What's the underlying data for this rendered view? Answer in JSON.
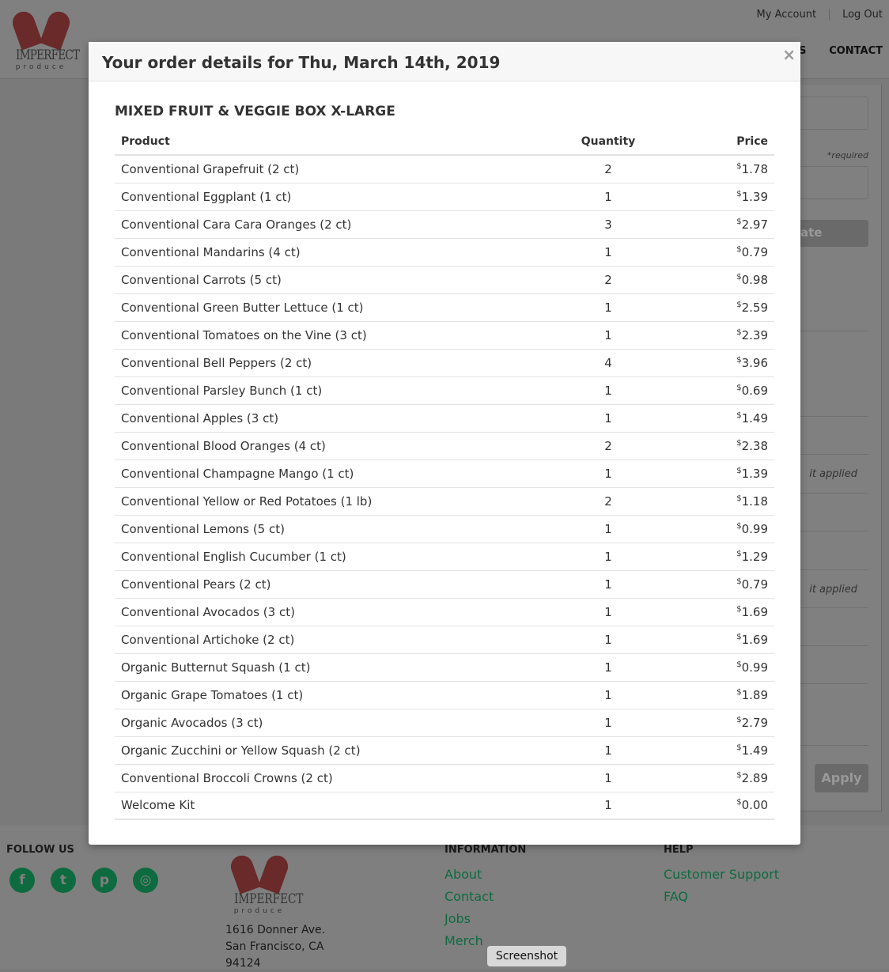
{
  "header": {
    "logo_top": "IMPERFECT",
    "logo_bottom": "produce",
    "my_account": "My Account",
    "log_out": "Log Out",
    "nav_partial": "S",
    "nav_contact": "CONTACT"
  },
  "sidebar": {
    "required": "*required",
    "update_partial": "ate",
    "credit_partial_1": "it applied",
    "credit_partial_2": "it applied",
    "apply": "Apply"
  },
  "modal": {
    "title": "Your order details for Thu, March 14th, 2019",
    "close": "×",
    "box_title": "MIXED FRUIT & VEGGIE BOX X-LARGE",
    "columns": {
      "product": "Product",
      "quantity": "Quantity",
      "price": "Price"
    },
    "currency": "$",
    "rows": [
      {
        "product": "Conventional Grapefruit (2 ct)",
        "quantity": "2",
        "price": "1.78"
      },
      {
        "product": "Conventional Eggplant (1 ct)",
        "quantity": "1",
        "price": "1.39"
      },
      {
        "product": "Conventional Cara Cara Oranges (2 ct)",
        "quantity": "3",
        "price": "2.97"
      },
      {
        "product": "Conventional Mandarins (4 ct)",
        "quantity": "1",
        "price": "0.79"
      },
      {
        "product": "Conventional Carrots (5 ct)",
        "quantity": "2",
        "price": "0.98"
      },
      {
        "product": "Conventional Green Butter Lettuce (1 ct)",
        "quantity": "1",
        "price": "2.59"
      },
      {
        "product": "Conventional Tomatoes on the Vine (3 ct)",
        "quantity": "1",
        "price": "2.39"
      },
      {
        "product": "Conventional Bell Peppers (2 ct)",
        "quantity": "4",
        "price": "3.96"
      },
      {
        "product": "Conventional Parsley Bunch (1 ct)",
        "quantity": "1",
        "price": "0.69"
      },
      {
        "product": "Conventional Apples (3 ct)",
        "quantity": "1",
        "price": "1.49"
      },
      {
        "product": "Conventional Blood Oranges (4 ct)",
        "quantity": "2",
        "price": "2.38"
      },
      {
        "product": "Conventional Champagne Mango (1 ct)",
        "quantity": "1",
        "price": "1.39"
      },
      {
        "product": "Conventional Yellow or Red Potatoes (1 lb)",
        "quantity": "2",
        "price": "1.18"
      },
      {
        "product": "Conventional Lemons (5 ct)",
        "quantity": "1",
        "price": "0.99"
      },
      {
        "product": "Conventional English Cucumber (1 ct)",
        "quantity": "1",
        "price": "1.29"
      },
      {
        "product": "Conventional Pears (2 ct)",
        "quantity": "1",
        "price": "0.79"
      },
      {
        "product": "Conventional Avocados (3 ct)",
        "quantity": "1",
        "price": "1.69"
      },
      {
        "product": "Conventional Artichoke (2 ct)",
        "quantity": "1",
        "price": "1.69"
      },
      {
        "product": "Organic Butternut Squash (1 ct)",
        "quantity": "1",
        "price": "0.99"
      },
      {
        "product": "Organic Grape Tomatoes (1 ct)",
        "quantity": "1",
        "price": "1.89"
      },
      {
        "product": "Organic Avocados (3 ct)",
        "quantity": "1",
        "price": "2.79"
      },
      {
        "product": "Organic Zucchini or Yellow Squash (2 ct)",
        "quantity": "1",
        "price": "1.49"
      },
      {
        "product": "Conventional Broccoli Crowns (2 ct)",
        "quantity": "1",
        "price": "2.89"
      },
      {
        "product": "Welcome Kit",
        "quantity": "1",
        "price": "0.00"
      }
    ]
  },
  "footer": {
    "follow_us": "FOLLOW US",
    "social": [
      "facebook-icon",
      "twitter-icon",
      "pinterest-icon",
      "instagram-icon"
    ],
    "address": [
      "1616 Donner Ave.",
      "San Francisco, CA",
      "94124"
    ],
    "information": {
      "heading": "INFORMATION",
      "links": [
        "About",
        "Contact",
        "Jobs",
        "Merch"
      ]
    },
    "help": {
      "heading": "HELP",
      "links": [
        "Customer Support",
        "FAQ"
      ]
    }
  },
  "tooltip": "Screenshot",
  "colors": {
    "link_green": "#0e6b3f",
    "overlay": "#808080"
  }
}
